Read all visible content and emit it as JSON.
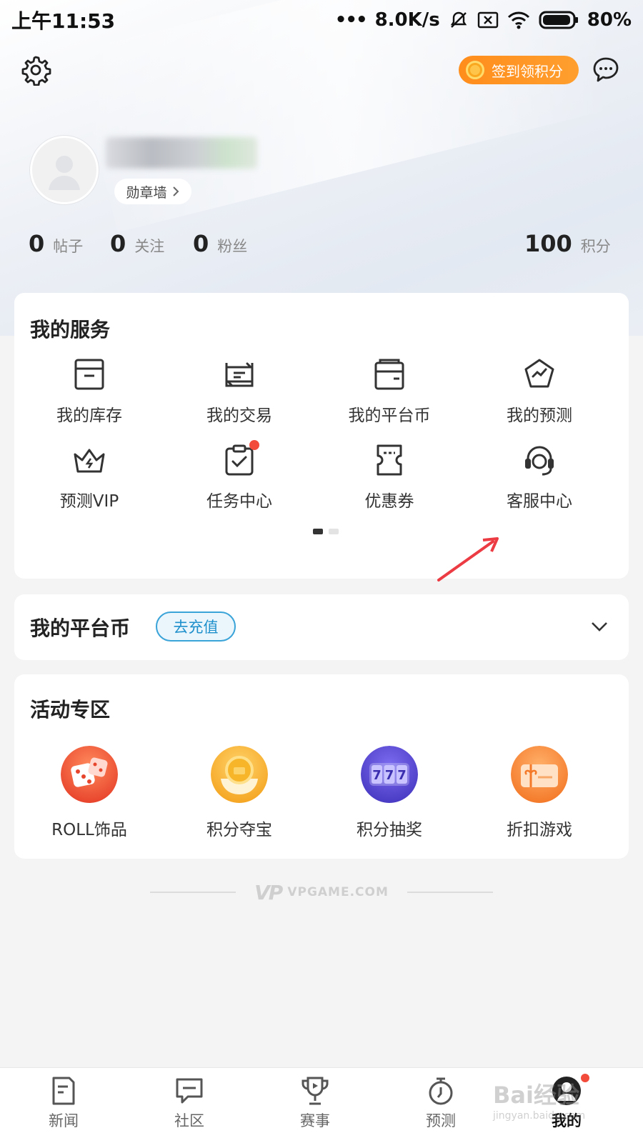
{
  "status_bar": {
    "time": "上午11:53",
    "network_speed": "8.0K/s",
    "battery": "80%"
  },
  "header": {
    "checkin_label": "签到领积分"
  },
  "profile": {
    "medal_wall_label": "勋章墙",
    "stats": [
      {
        "value": "0",
        "label": "帖子"
      },
      {
        "value": "0",
        "label": "关注"
      },
      {
        "value": "0",
        "label": "粉丝"
      }
    ],
    "points": {
      "value": "100",
      "label": "积分"
    }
  },
  "services": {
    "title": "我的服务",
    "items": [
      {
        "label": "我的库存",
        "icon": "inventory-icon"
      },
      {
        "label": "我的交易",
        "icon": "trade-icon"
      },
      {
        "label": "我的平台币",
        "icon": "wallet-icon"
      },
      {
        "label": "我的预测",
        "icon": "prediction-icon"
      },
      {
        "label": "预测VIP",
        "icon": "crown-icon"
      },
      {
        "label": "任务中心",
        "icon": "task-icon"
      },
      {
        "label": "优惠券",
        "icon": "coupon-icon"
      },
      {
        "label": "客服中心",
        "icon": "headset-icon"
      }
    ]
  },
  "platform_coins": {
    "title": "我的平台币",
    "recharge_label": "去充值"
  },
  "events": {
    "title": "活动专区",
    "items": [
      {
        "label": "ROLL饰品",
        "icon": "dice-icon"
      },
      {
        "label": "积分夺宝",
        "icon": "treasure-icon"
      },
      {
        "label": "积分抽奖",
        "icon": "slot-machine-icon"
      },
      {
        "label": "折扣游戏",
        "icon": "gift-card-icon"
      }
    ]
  },
  "footer": {
    "brand_mark": "VP",
    "brand_text": "VPGAME.COM"
  },
  "tabbar": {
    "items": [
      {
        "label": "新闻",
        "icon": "news-icon"
      },
      {
        "label": "社区",
        "icon": "community-icon"
      },
      {
        "label": "赛事",
        "icon": "trophy-icon"
      },
      {
        "label": "预测",
        "icon": "stopwatch-icon"
      },
      {
        "label": "我的",
        "icon": "profile-icon"
      }
    ]
  },
  "watermark": {
    "text": "Bai经验",
    "url": "jingyan.baidu.com"
  },
  "colors": {
    "accent_orange": "#ff8d1c",
    "recharge_blue": "#1f90cc",
    "badge_red": "#f24b3c"
  }
}
